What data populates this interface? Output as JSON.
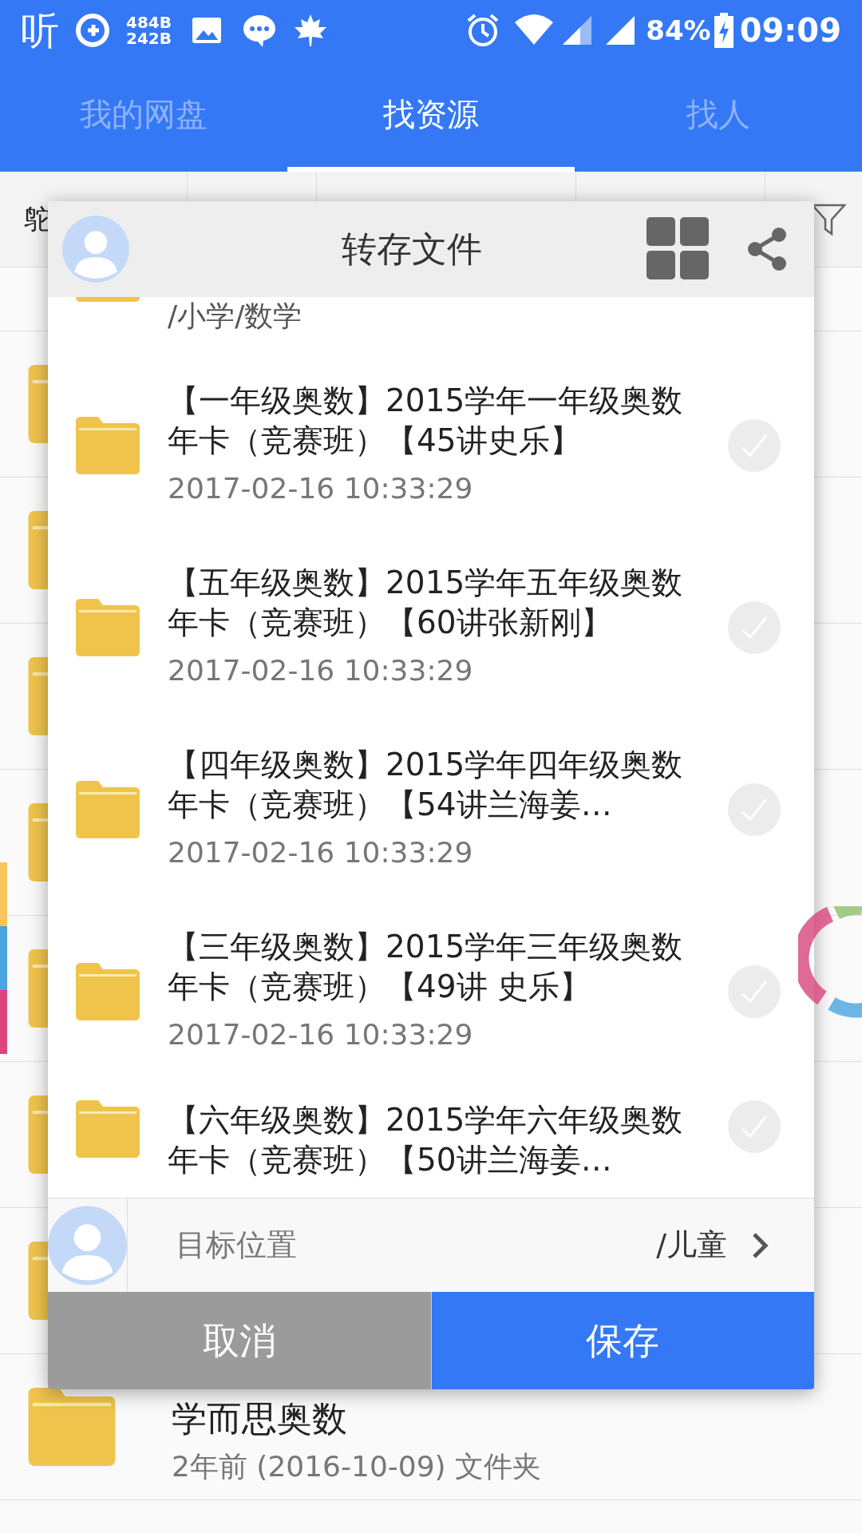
{
  "status_bar": {
    "app_logo": "听",
    "speed_up": "484B",
    "speed_down": "242B",
    "battery": "84%",
    "time": "09:09"
  },
  "tabs": [
    {
      "label": "我的网盘",
      "selected": false
    },
    {
      "label": "找资源",
      "selected": true
    },
    {
      "label": "找人",
      "selected": false
    }
  ],
  "filter_bar": {
    "column_1": "鸵"
  },
  "background_list": {
    "rows": [
      {
        "title": "学而思奥数",
        "subtitle": "2年前 (2016-10-09) 文件夹"
      }
    ]
  },
  "dialog": {
    "title": "转存文件",
    "partial_item": {
      "title": "/小学/数学"
    },
    "items": [
      {
        "title": "【一年级奥数】2015学年一年级奥数年卡（竞赛班）【45讲史乐】",
        "time": "2017-02-16 10:33:29",
        "selected": false
      },
      {
        "title": "【五年级奥数】2015学年五年级奥数年卡（竞赛班）【60讲张新刚】",
        "time": "2017-02-16 10:33:29",
        "selected": false
      },
      {
        "title": "【四年级奥数】2015学年四年级奥数年卡（竞赛班）【54讲兰海姜…",
        "time": "2017-02-16 10:33:29",
        "selected": false
      },
      {
        "title": "【三年级奥数】2015学年三年级奥数年卡（竞赛班）【49讲 史乐】",
        "time": "2017-02-16 10:33:29",
        "selected": false
      },
      {
        "title": "【六年级奥数】2015学年六年级奥数年卡（竞赛班）【50讲兰海姜…",
        "selected": false
      }
    ],
    "target": {
      "label": "目标位置",
      "value": "/儿童"
    },
    "buttons": [
      {
        "label": "取消",
        "kind": "cancel"
      },
      {
        "label": "保存",
        "kind": "save"
      }
    ]
  }
}
